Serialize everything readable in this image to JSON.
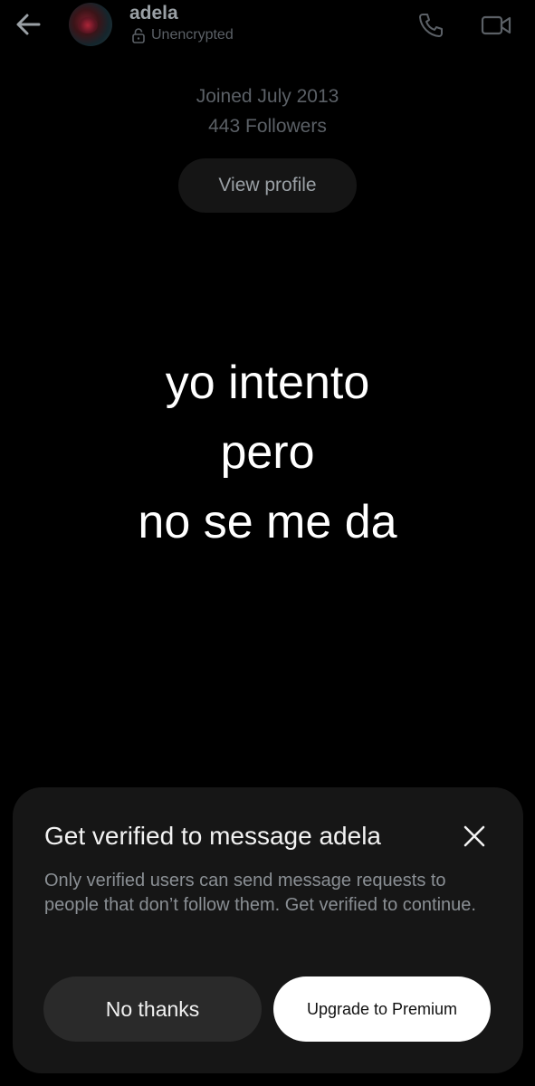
{
  "header": {
    "back_icon": "arrow-left-icon",
    "name": "adela",
    "encryption_icon": "unlocked-padlock-icon",
    "encryption_status": "Unencrypted",
    "call_icon": "phone-icon",
    "video_icon": "video-camera-icon"
  },
  "profile": {
    "joined": "Joined July 2013",
    "followers": "443 Followers",
    "view_profile_label": "View profile"
  },
  "caption": {
    "lines": [
      "yo intento",
      "pero",
      "no se me da"
    ]
  },
  "sheet": {
    "title": "Get verified to message adela",
    "close_icon": "close-icon",
    "body": "Only verified users can send message requests to people that don’t follow them.  Get verified to continue.",
    "secondary_button": "No thanks",
    "primary_button": "Upgrade to Premium"
  },
  "colors": {
    "background": "#000000",
    "sheet_background": "#161616",
    "muted_text": "#5b6066",
    "primary_button_bg": "#ffffff",
    "secondary_button_bg": "#2a2a2a"
  }
}
